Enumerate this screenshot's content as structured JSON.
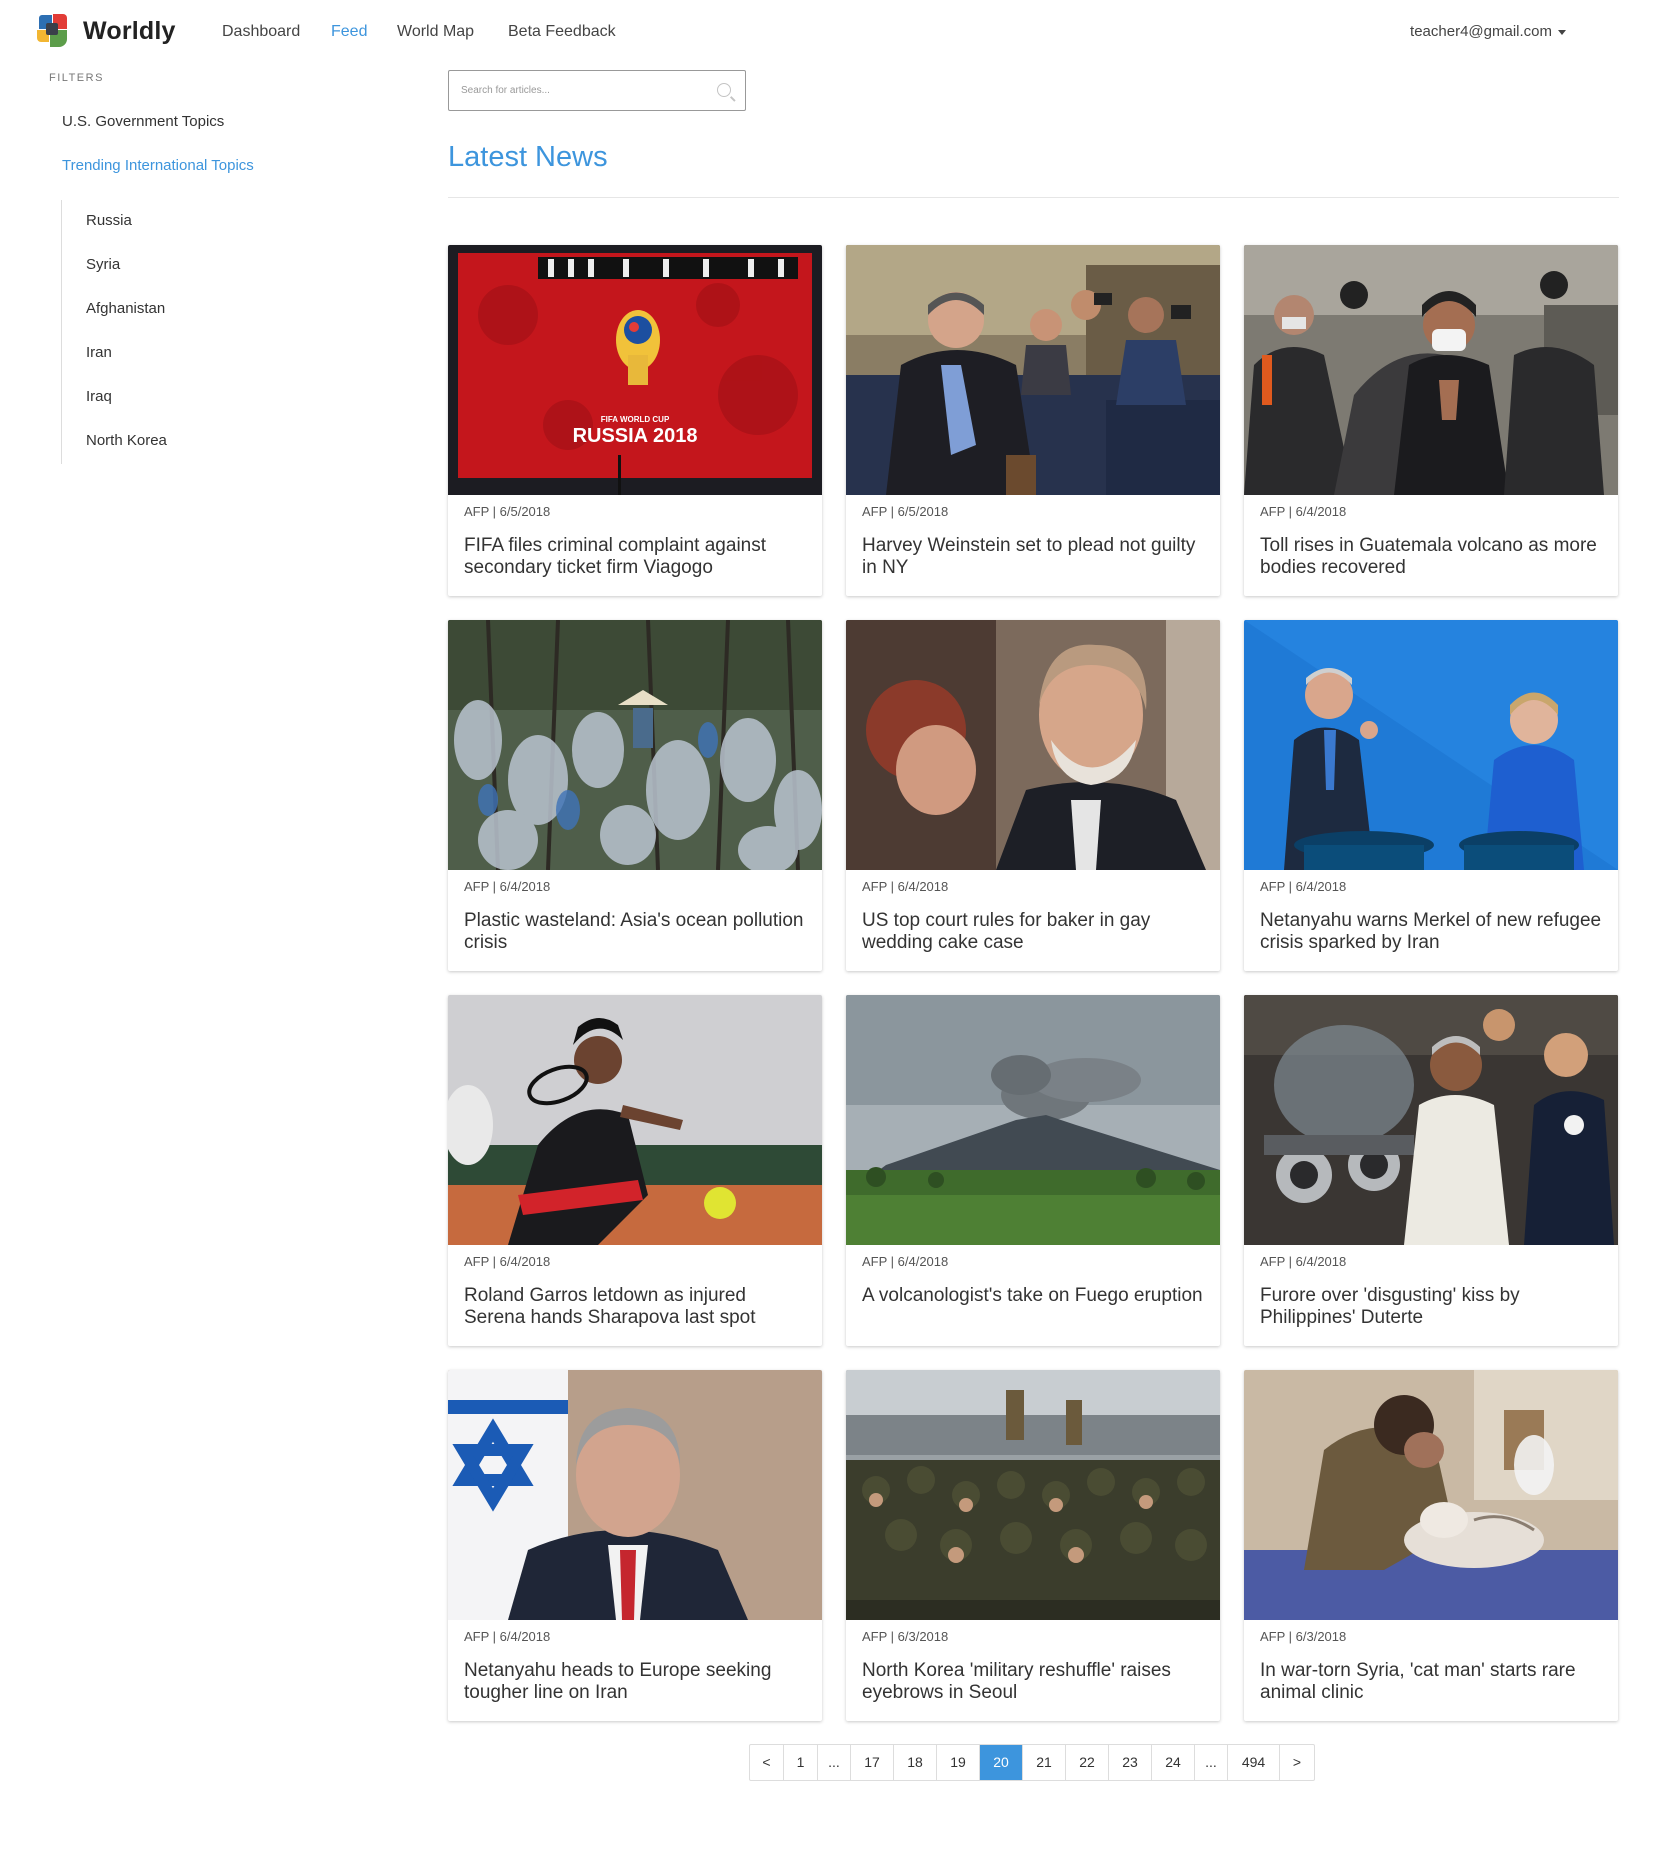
{
  "brand": {
    "name": "Worldly"
  },
  "nav": {
    "items": [
      {
        "label": "Dashboard",
        "active": false
      },
      {
        "label": "Feed",
        "active": true
      },
      {
        "label": "World Map",
        "active": false
      },
      {
        "label": "Beta Feedback",
        "active": false
      }
    ],
    "user_email": "teacher4@gmail.com"
  },
  "sidebar": {
    "filters_label": "FILTERS",
    "sections": [
      {
        "label": "U.S. Government Topics",
        "active": false
      },
      {
        "label": "Trending International Topics",
        "active": true
      }
    ],
    "sub_items": [
      "Russia",
      "Syria",
      "Afghanistan",
      "Iran",
      "Iraq",
      "North Korea"
    ]
  },
  "search": {
    "placeholder": "Search for articles..."
  },
  "main": {
    "title": "Latest News"
  },
  "articles": [
    {
      "meta": "AFP | 6/5/2018",
      "title": "FIFA files criminal complaint against secondary ticket firm Viagogo",
      "image": "fifa-world-cup-russia-2018-image"
    },
    {
      "meta": "AFP | 6/5/2018",
      "title": "Harvey Weinstein set to plead not guilty in NY",
      "image": "weinstein-court-image"
    },
    {
      "meta": "AFP | 6/4/2018",
      "title": "Toll rises in Guatemala volcano as more bodies recovered",
      "image": "guatemala-mourner-image"
    },
    {
      "meta": "AFP | 6/4/2018",
      "title": "Plastic wasteland: Asia's ocean pollution crisis",
      "image": "plastic-waste-trees-image"
    },
    {
      "meta": "AFP | 6/4/2018",
      "title": "US top court rules for baker in gay wedding cake case",
      "image": "baker-portrait-image"
    },
    {
      "meta": "AFP | 6/4/2018",
      "title": "Netanyahu warns Merkel of new refugee crisis sparked by Iran",
      "image": "netanyahu-merkel-podium-image"
    },
    {
      "meta": "AFP | 6/4/2018",
      "title": "Roland Garros letdown as injured Serena hands Sharapova last spot",
      "image": "serena-tennis-image"
    },
    {
      "meta": "AFP | 6/4/2018",
      "title": "A volcanologist's take on Fuego eruption",
      "image": "fuego-volcano-image"
    },
    {
      "meta": "AFP | 6/4/2018",
      "title": "Furore over 'disgusting' kiss by Philippines' Duterte",
      "image": "duterte-motorcycle-image"
    },
    {
      "meta": "AFP | 6/4/2018",
      "title": "Netanyahu heads to Europe seeking tougher line on Iran",
      "image": "netanyahu-flag-image"
    },
    {
      "meta": "AFP | 6/3/2018",
      "title": "North Korea 'military reshuffle' raises eyebrows in Seoul",
      "image": "north-korea-soldiers-image"
    },
    {
      "meta": "AFP | 6/3/2018",
      "title": "In war-torn Syria, 'cat man' starts rare animal clinic",
      "image": "syria-cat-clinic-image"
    }
  ],
  "pagination": {
    "pages": [
      "<",
      "1",
      "...",
      "17",
      "18",
      "19",
      "20",
      "21",
      "22",
      "23",
      "24",
      "...",
      "494",
      ">"
    ],
    "current": "20"
  },
  "colors": {
    "accent": "#3d95dd"
  }
}
